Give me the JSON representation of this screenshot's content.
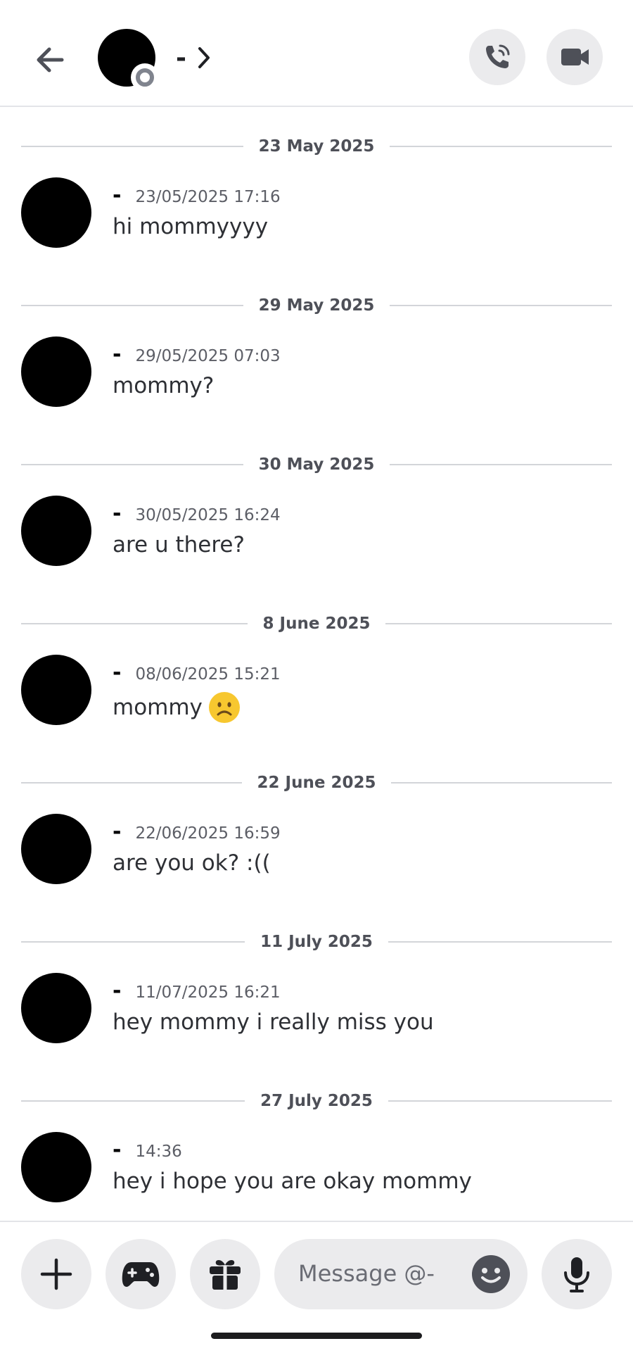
{
  "header": {
    "name": "-",
    "chevron": "›",
    "icons": {
      "back": "arrow-left-icon",
      "call": "phone-icon",
      "video": "video-camera-icon",
      "status": "offline-status-icon"
    }
  },
  "messages": [
    {
      "date_divider": "23 May 2025",
      "author": "-",
      "timestamp": "23/05/2025 17:16",
      "text": "hi mommyyyy"
    },
    {
      "date_divider": "29 May 2025",
      "author": "-",
      "timestamp": "29/05/2025 07:03",
      "text": "mommy?"
    },
    {
      "date_divider": "30 May 2025",
      "author": "-",
      "timestamp": "30/05/2025 16:24",
      "text": "are u there?"
    },
    {
      "date_divider": "8 June 2025",
      "author": "-",
      "timestamp": "08/06/2025 15:21",
      "text": "mommy",
      "emoji": "frowning-face"
    },
    {
      "date_divider": "22 June 2025",
      "author": "-",
      "timestamp": "22/06/2025 16:59",
      "text": "are you ok? :(("
    },
    {
      "date_divider": "11 July 2025",
      "author": "-",
      "timestamp": "11/07/2025 16:21",
      "text": "hey mommy i really miss you"
    },
    {
      "date_divider": "27 July 2025",
      "author": "-",
      "timestamp": "14:36",
      "text": "hey i hope you are okay mommy"
    }
  ],
  "composer": {
    "placeholder": "Message @-",
    "icons": {
      "attach": "plus-icon",
      "activities": "gamepad-icon",
      "gift": "gift-icon",
      "emoji": "emoji-smile-icon",
      "voice": "microphone-icon"
    }
  },
  "colors": {
    "button_bg": "#ebebed",
    "divider_line": "#d3d5d9",
    "text_primary": "#2e3035",
    "text_muted": "#5c5e66",
    "emoji_yellow": "#f7c72f"
  }
}
